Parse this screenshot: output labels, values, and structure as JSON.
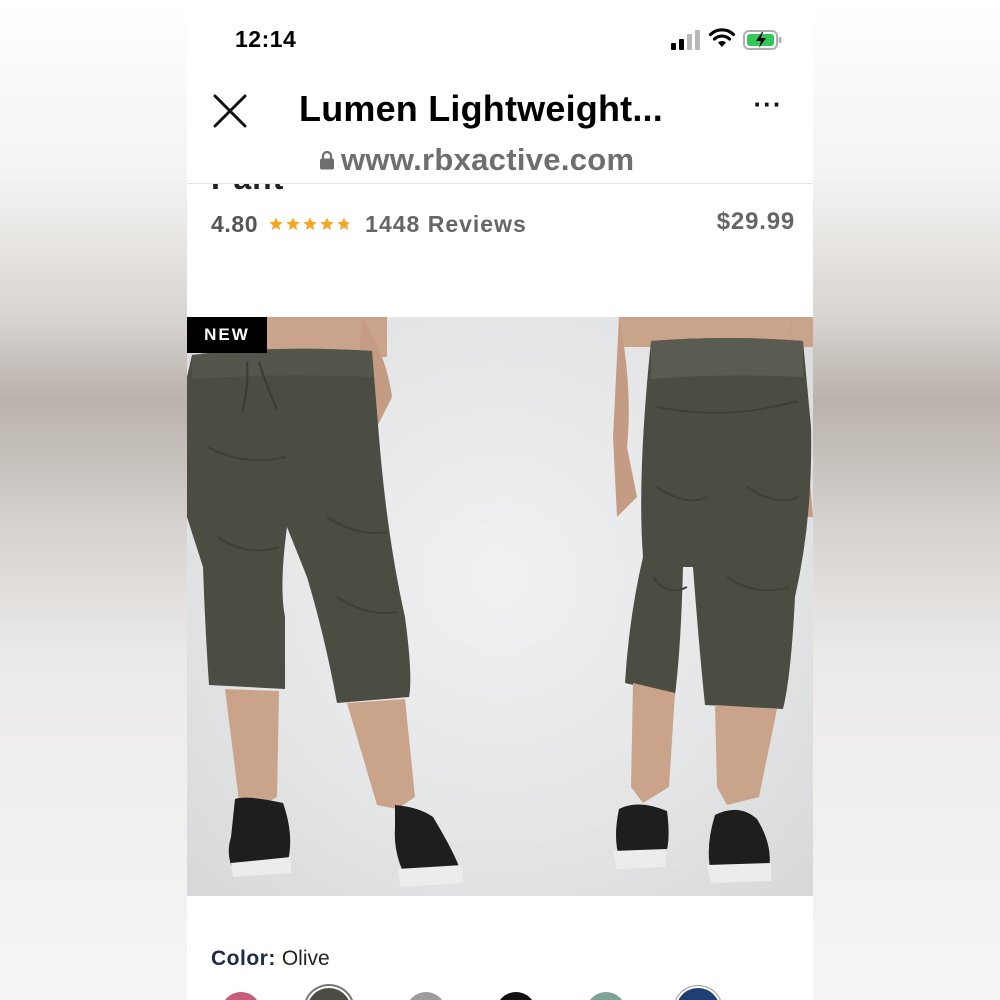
{
  "status_bar": {
    "time": "12:14"
  },
  "browser": {
    "title": "Lumen Lightweight...",
    "url": "www.rbxactive.com",
    "icons": [
      "close-icon",
      "more-icon",
      "lock-icon"
    ]
  },
  "product": {
    "name_partial": "Pant",
    "rating": "4.80",
    "stars": 4.8,
    "reviews": "1448 Reviews",
    "price": "$29.99",
    "badge": "NEW",
    "color_label": "Color:",
    "color_value": "Olive"
  },
  "colors": {
    "star": "#f5a623",
    "pant": "#4b4c42",
    "swatches": [
      "#c65d7b",
      "#4b4c42",
      "#9c9c9c",
      "#111111",
      "#7fa396",
      "#1f3f74"
    ]
  }
}
